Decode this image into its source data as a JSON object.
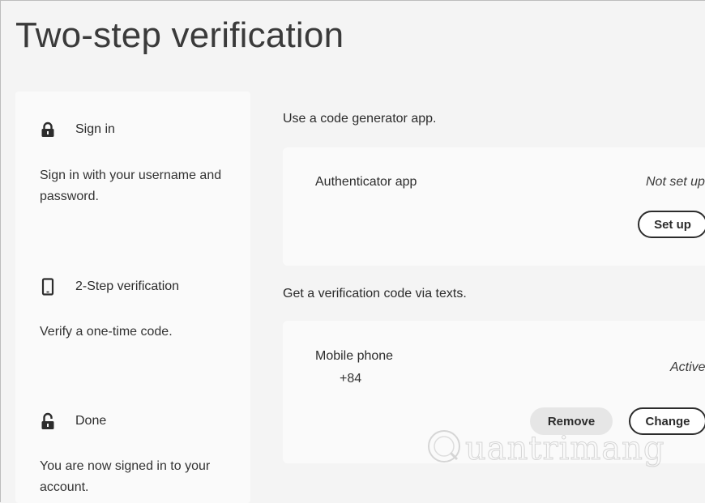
{
  "page": {
    "title": "Two-step verification"
  },
  "sidebar": {
    "steps": [
      {
        "icon": "lock-icon",
        "label": "Sign in",
        "description": "Sign in with your username and password."
      },
      {
        "icon": "phone-icon",
        "label": "2-Step verification",
        "description": "Verify a one-time code."
      },
      {
        "icon": "unlock-icon",
        "label": "Done",
        "description": "You are now signed in to your account."
      }
    ]
  },
  "authenticator": {
    "section_label": "Use a code generator app.",
    "title": "Authenticator app",
    "status": "Not set up",
    "setup_label": "Set up"
  },
  "sms": {
    "section_label": "Get a verification code via texts.",
    "title": "Mobile phone",
    "phone": "+84",
    "status": "Active",
    "remove_label": "Remove",
    "change_label": "Change"
  },
  "watermark": {
    "text": "uantrimang"
  },
  "colors": {
    "background": "#f4f4f4",
    "card": "#fafafa",
    "text": "#2c2c2c",
    "quiet_button": "#e6e6e6"
  }
}
